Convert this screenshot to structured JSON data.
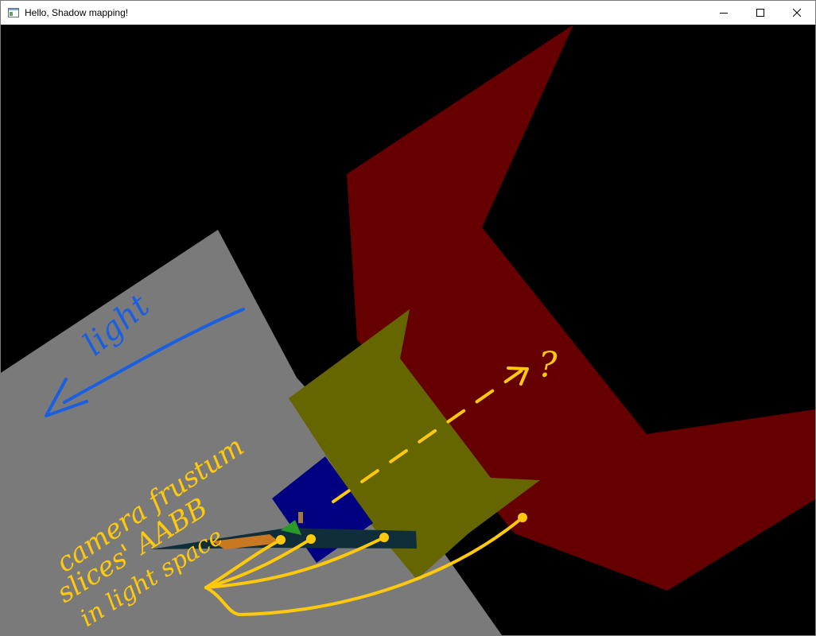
{
  "window": {
    "title": "Hello, Shadow mapping!",
    "icon": "app-window-icon",
    "controls": [
      "minimize-icon",
      "maximize-icon",
      "close-icon"
    ]
  },
  "scene": {
    "background_color": "#000000",
    "colors": {
      "ground_plane": "#7a7a7a",
      "red_frustum_aabb": "#660000",
      "yellow_frustum_aabb": "#666600",
      "blue_frustum_aabb": "#000080",
      "light_annotation": "#1a5fe0",
      "camera_annotation": "#ffc90e"
    }
  },
  "annotations": {
    "light": "light",
    "question": "?",
    "camera_line1": "camera frustum",
    "camera_line2": "slices' AABB",
    "camera_line3": "in light space"
  }
}
